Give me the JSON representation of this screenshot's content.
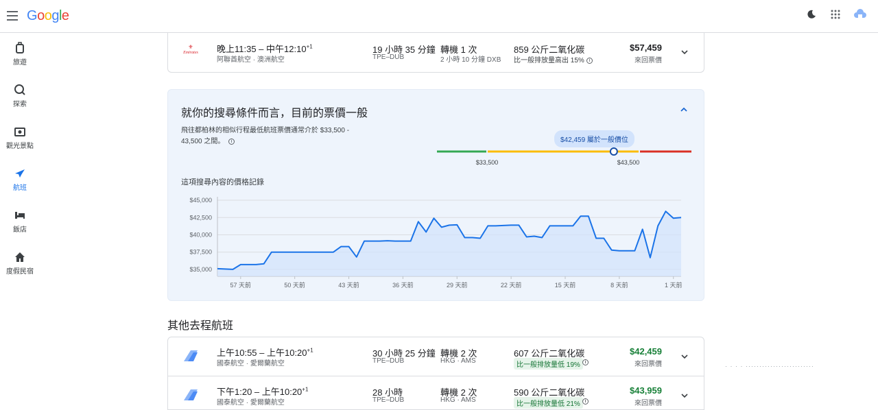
{
  "header": {
    "logo": "Google",
    "menu_icon": "menu-icon",
    "dark_mode_icon": "moon-icon",
    "apps_icon": "apps-grid-icon",
    "account_icon": "account-cloud-icon"
  },
  "sidebar": {
    "items": [
      {
        "label": "旅遊",
        "icon": "luggage-icon"
      },
      {
        "label": "探索",
        "icon": "explore-icon"
      },
      {
        "label": "觀光景點",
        "icon": "camera-icon"
      },
      {
        "label": "航班",
        "icon": "flight-icon",
        "active": true
      },
      {
        "label": "飯店",
        "icon": "hotel-icon"
      },
      {
        "label": "度假民宿",
        "icon": "home-icon"
      }
    ]
  },
  "top_flight": {
    "airline_logo_text": "Emirates",
    "time": "晚上11:35 – 中午12:10",
    "plus_day": "+1",
    "airline": "阿聯酋航空 · 澳洲航空",
    "duration": "19 小時 35 分鐘",
    "route": "TPE–DUB",
    "stops": "轉機 1 次",
    "via": "2 小時 10 分鐘 DXB",
    "co2": "859 公斤二氧化碳",
    "co2_note": "比一般排放量高出 15%",
    "price": "$57,459",
    "price_type": "來回票價"
  },
  "insight": {
    "title": "就你的搜尋條件而言，目前的票價一般",
    "desc_line1": "飛往都柏林的相似行程最低航班票價通常介於 $33,500 -",
    "desc_line2": "43,500 之間。",
    "badge": "$42,459 屬於一般價位",
    "low_label": "$33,500",
    "high_label": "$43,500",
    "current_fraction": 0.695,
    "history_title": "這項搜尋內容的價格記錄",
    "colors": {
      "low": "#34a853",
      "typical": "#fbbc04",
      "high": "#ea4335",
      "line": "#1a73e8"
    }
  },
  "chart_data": {
    "type": "area",
    "title": "這項搜尋內容的價格記錄",
    "ylim": [
      34000,
      45500
    ],
    "yticks": [
      "$45,000",
      "$42,500",
      "$40,000",
      "$37,500",
      "$35,000"
    ],
    "ytick_values": [
      45000,
      42500,
      40000,
      37500,
      35000
    ],
    "xticks": [
      "57 天前",
      "50 天前",
      "43 天前",
      "36 天前",
      "29 天前",
      "22 天前",
      "15 天前",
      "8 天前",
      "1 天前"
    ],
    "xtick_values": [
      -57,
      -50,
      -43,
      -36,
      -29,
      -22,
      -15,
      -8,
      -1
    ],
    "xlim": [
      -60,
      0
    ],
    "x": [
      -60,
      -58,
      -57,
      -56,
      -55,
      -54,
      -53,
      -52,
      -51,
      -50,
      -49,
      -48,
      -47,
      -46,
      -45,
      -44,
      -43,
      -42,
      -41,
      -40,
      -39,
      -38,
      -37,
      -36,
      -35,
      -34,
      -33,
      -32,
      -31,
      -30,
      -29,
      -28,
      -27,
      -26,
      -25,
      -24,
      -23,
      -22,
      -21,
      -20,
      -19,
      -18,
      -17,
      -16,
      -15,
      -14,
      -13,
      -12,
      -11,
      -10,
      -9,
      -8,
      -7,
      -6,
      -5,
      -4,
      -3,
      -2,
      -1,
      0
    ],
    "values": [
      35100,
      35000,
      35700,
      35700,
      35700,
      35800,
      37500,
      37500,
      37500,
      37500,
      37500,
      37500,
      37500,
      37500,
      37500,
      38300,
      38300,
      36800,
      39100,
      39100,
      39100,
      39150,
      39100,
      39100,
      39100,
      41900,
      40400,
      42400,
      41100,
      41400,
      41450,
      39600,
      39600,
      39500,
      41300,
      41300,
      41350,
      41400,
      41400,
      39700,
      39800,
      39600,
      41300,
      41300,
      41300,
      41300,
      42700,
      42700,
      39500,
      39500,
      37800,
      37700,
      37700,
      37700,
      40800,
      36700,
      41300,
      43400,
      42400,
      42500
    ],
    "series_color": "#1a73e8"
  },
  "other_section": {
    "title": "其他去程航班"
  },
  "other_flights": [
    {
      "time": "上午10:55 – 上午10:20",
      "plus_day": "+1",
      "airline": "國泰航空 · 愛爾蘭航空",
      "duration": "30 小時 25 分鐘",
      "route": "TPE–DUB",
      "stops": "轉機 2 次",
      "via": "HKG · AMS",
      "co2": "607 公斤二氧化碳",
      "co2_note": "比一般排放量低 19%",
      "price": "$42,459",
      "price_type": "來回票價"
    },
    {
      "time": "下午1:20 – 上午10:20",
      "plus_day": "+1",
      "airline": "國泰航空 · 愛爾蘭航空",
      "duration": "28 小時",
      "route": "TPE–DUB",
      "stops": "轉機 2 次",
      "via": "HKG · AMS",
      "co2": "590 公斤二氧化碳",
      "co2_note": "比一般排放量低 21%",
      "price": "$43,959",
      "price_type": "來回票價"
    }
  ]
}
